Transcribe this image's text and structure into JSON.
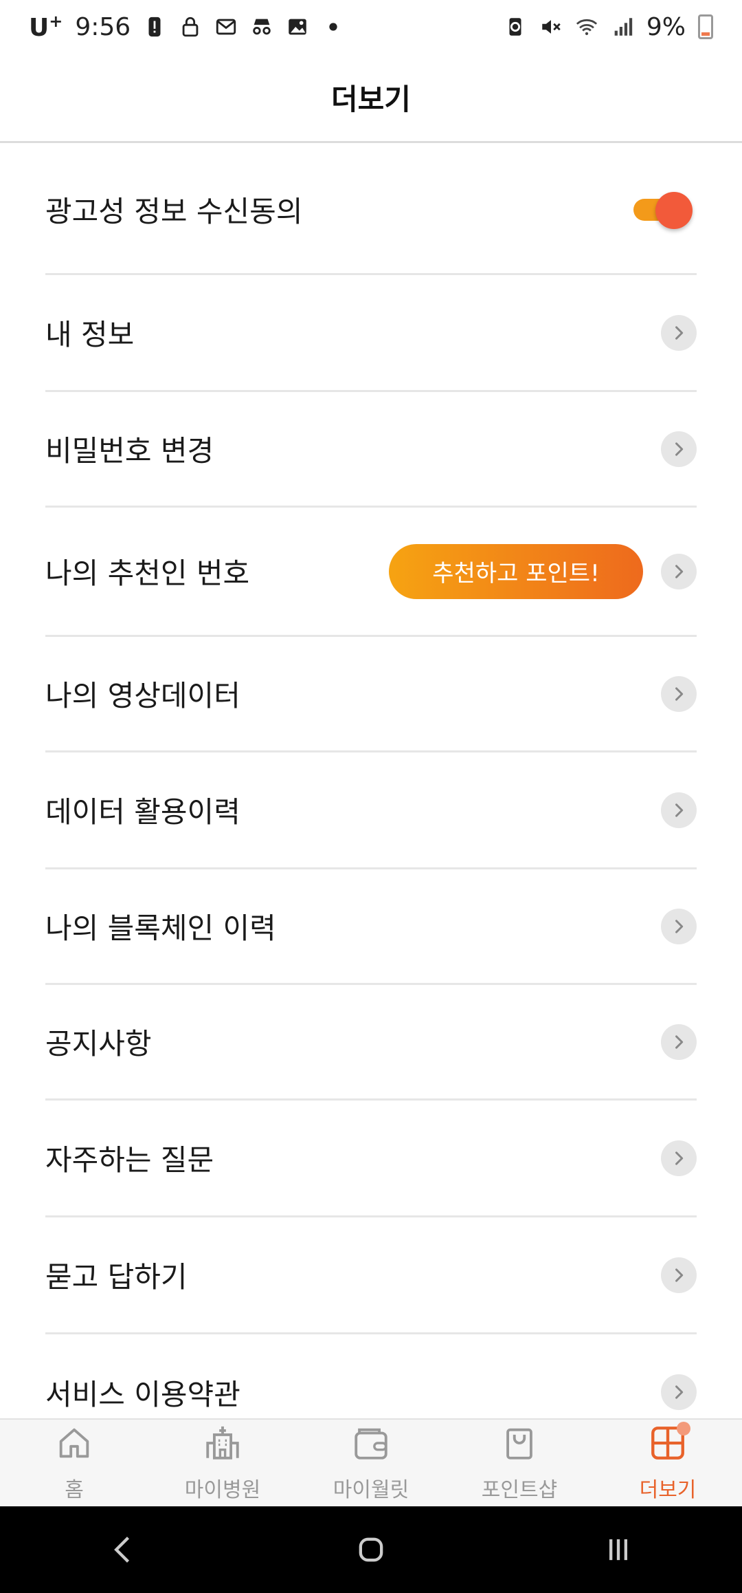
{
  "status_bar": {
    "carrier": "U",
    "carrier_sup": "+",
    "time": "9:56",
    "battery": "9%"
  },
  "header": {
    "title": "더보기"
  },
  "menu": [
    {
      "label": "광고성 정보 수신동의",
      "control": "toggle",
      "toggle_on": true
    },
    {
      "label": "내 정보",
      "control": "chevron"
    },
    {
      "label": "비밀번호 변경",
      "control": "chevron"
    },
    {
      "label": "나의 추천인 번호",
      "control": "chevron",
      "promo": "추천하고 포인트!"
    },
    {
      "label": "나의 영상데이터",
      "control": "chevron"
    },
    {
      "label": "데이터 활용이력",
      "control": "chevron"
    },
    {
      "label": "나의 블록체인 이력",
      "control": "chevron"
    },
    {
      "label": "공지사항",
      "control": "chevron"
    },
    {
      "label": "자주하는 질문",
      "control": "chevron"
    },
    {
      "label": "묻고 답하기",
      "control": "chevron"
    },
    {
      "label": "서비스 이용약관",
      "control": "chevron"
    }
  ],
  "bottom_nav": [
    {
      "label": "홈",
      "icon": "home-icon"
    },
    {
      "label": "마이병원",
      "icon": "hospital-icon"
    },
    {
      "label": "마이월릿",
      "icon": "wallet-icon"
    },
    {
      "label": "포인트샵",
      "icon": "shopping-bag-icon"
    },
    {
      "label": "더보기",
      "icon": "grid-icon",
      "active": true
    }
  ],
  "colors": {
    "accent": "#e8622a",
    "toggle_track": "#f39a1a",
    "toggle_knob": "#f25a3a",
    "promo_start": "#f6a312",
    "promo_end": "#ee6a1d"
  }
}
